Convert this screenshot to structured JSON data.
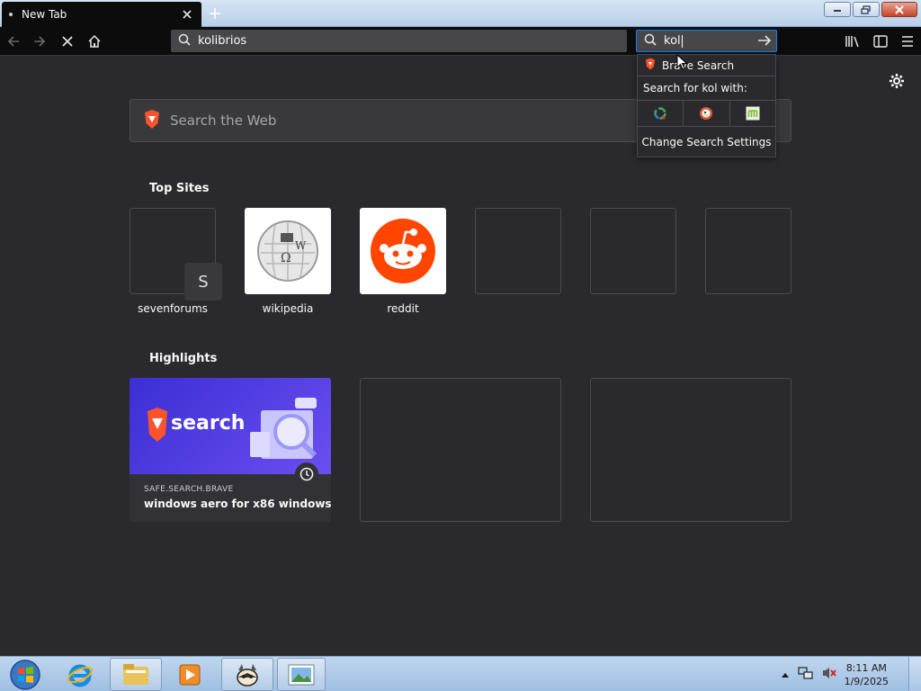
{
  "tab": {
    "title": "New Tab"
  },
  "urlbar": {
    "value": "kolibrios"
  },
  "searchbar": {
    "value": "kol"
  },
  "search_popup": {
    "engine_name": "Brave Search",
    "search_for_label": "Search for kol with:",
    "engines": [
      "qwant-icon",
      "duckduckgo-icon",
      "mojeek-icon"
    ],
    "settings_label": "Change Search Settings"
  },
  "newtab": {
    "search_placeholder": "Search the Web",
    "top_sites_title": "Top Sites",
    "top_sites": [
      {
        "label": "sevenforums",
        "badge": "S"
      },
      {
        "label": "wikipedia"
      },
      {
        "label": "reddit"
      }
    ],
    "highlights_title": "Highlights",
    "highlights": [
      {
        "image_text": "search",
        "site": "SAFE.SEARCH.BRAVE",
        "title": "windows aero for x86 windows ..."
      }
    ]
  },
  "taskbar": {
    "time": "8:11 AM",
    "date": "1/9/2025"
  },
  "colors": {
    "accent": "#0a84ff",
    "page_bg": "#2a2a2e",
    "toolbar_bg": "#0c0c0d",
    "reddit": "#ff4500",
    "brave": "#fb542b"
  }
}
